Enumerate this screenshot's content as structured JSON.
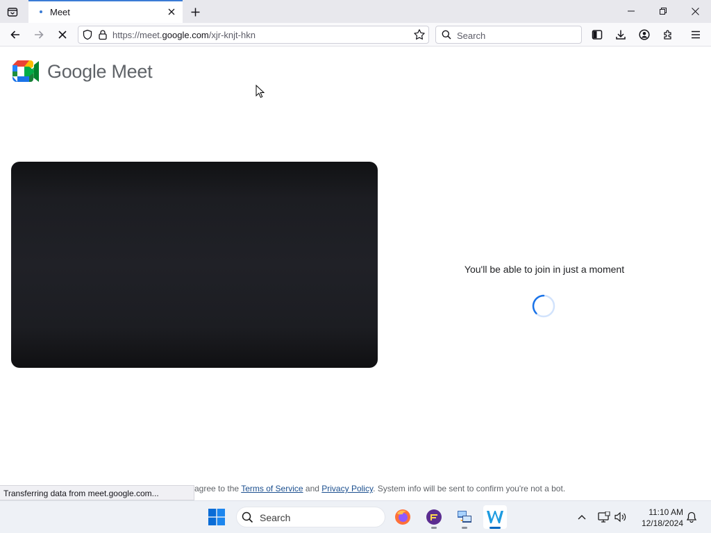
{
  "browser": {
    "tab": {
      "title": "Meet",
      "accent": "#3a7bd5"
    },
    "url": {
      "prefix": "https://meet.",
      "domain": "google.com",
      "path": "/xjr-knjt-hkn"
    },
    "search_placeholder": "Search",
    "status_text": "Transferring data from meet.google.com..."
  },
  "page": {
    "logo_text": "Google Meet",
    "join_message": "You'll be able to join in just a moment",
    "legal": {
      "prefix": "agree to the",
      "terms": "Terms of Service",
      "and": "and",
      "privacy": "Privacy Policy",
      "suffix": ". System info will be sent to confirm you're not a bot."
    },
    "spinner_color": "#1a73e8"
  },
  "taskbar": {
    "search_placeholder": "Search",
    "apps": [
      "firefox-icon",
      "pinned-app-icon",
      "file-transfer-icon",
      "word-app-icon"
    ],
    "time": "11:10 AM",
    "date": "12/18/2024"
  }
}
